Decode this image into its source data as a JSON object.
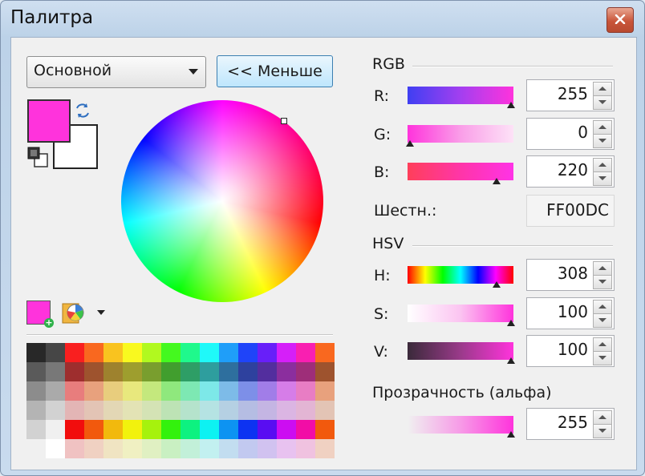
{
  "window": {
    "title": "Палитра"
  },
  "colors": {
    "primary": "#ff33dc",
    "secondary": "#ffffff",
    "accent": "#3c7fb1"
  },
  "mode_select": {
    "value": "Основной"
  },
  "less_button": {
    "label": "<< Меньше"
  },
  "rgb": {
    "header": "RGB",
    "r": {
      "label": "R:",
      "value": "255",
      "level": 1.0
    },
    "g": {
      "label": "G:",
      "value": "0",
      "level": 0.0
    },
    "b": {
      "label": "B:",
      "value": "220",
      "level": 0.86
    },
    "hex_label": "Шестн.:",
    "hex_value": "FF00DC"
  },
  "hsv": {
    "header": "HSV",
    "h": {
      "label": "H:",
      "value": "308",
      "level": 0.86
    },
    "s": {
      "label": "S:",
      "value": "100",
      "level": 1.0
    },
    "v": {
      "label": "V:",
      "value": "100",
      "level": 1.0
    }
  },
  "alpha": {
    "label": "Прозрачность (альфа)",
    "value": "255",
    "level": 1.0
  },
  "icons": [
    "close-icon",
    "swap-colors-icon",
    "reset-colors-icon",
    "add-color-icon",
    "palette-menu-icon",
    "chevron-down-icon"
  ]
}
